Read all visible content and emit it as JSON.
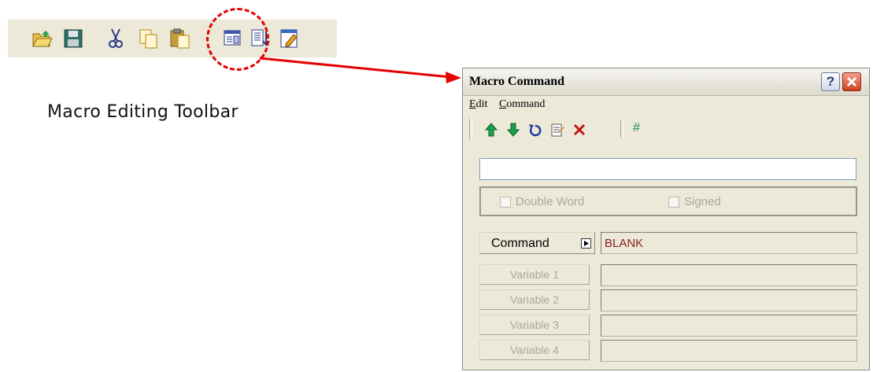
{
  "caption": "Macro Editing Toolbar",
  "toolbar": {
    "buttons": [
      {
        "icon": "open-folder-icon"
      },
      {
        "icon": "save-disk-icon"
      },
      {
        "icon": "cut-scissors-icon"
      },
      {
        "icon": "copy-icon"
      },
      {
        "icon": "paste-icon"
      },
      {
        "icon": "macro-editor-icon"
      },
      {
        "icon": "insert-command-icon"
      },
      {
        "icon": "edit-document-icon"
      }
    ],
    "highlighted": "macro-editor-icon",
    "highlight_color": "#e60000"
  },
  "dialog": {
    "title": "Macro Command",
    "help_label": "?",
    "menu": [
      {
        "accel": "E",
        "rest": "dit"
      },
      {
        "accel": "C",
        "rest": "ommand"
      }
    ],
    "tools": [
      "move-up-icon",
      "move-down-icon",
      "undo-icon",
      "notepad-icon",
      "delete-icon"
    ],
    "hash_label": "#",
    "expression_value": "",
    "options": {
      "double_word": "Double Word",
      "signed": "Signed"
    },
    "command_label": "Command",
    "command_value": "BLANK",
    "variables": [
      "Variable 1",
      "Variable 2",
      "Variable 3",
      "Variable 4"
    ],
    "colors": {
      "command_text": "#8b1a1a",
      "disabled_text": "#aca899",
      "hash": "#1a8a5a"
    }
  }
}
